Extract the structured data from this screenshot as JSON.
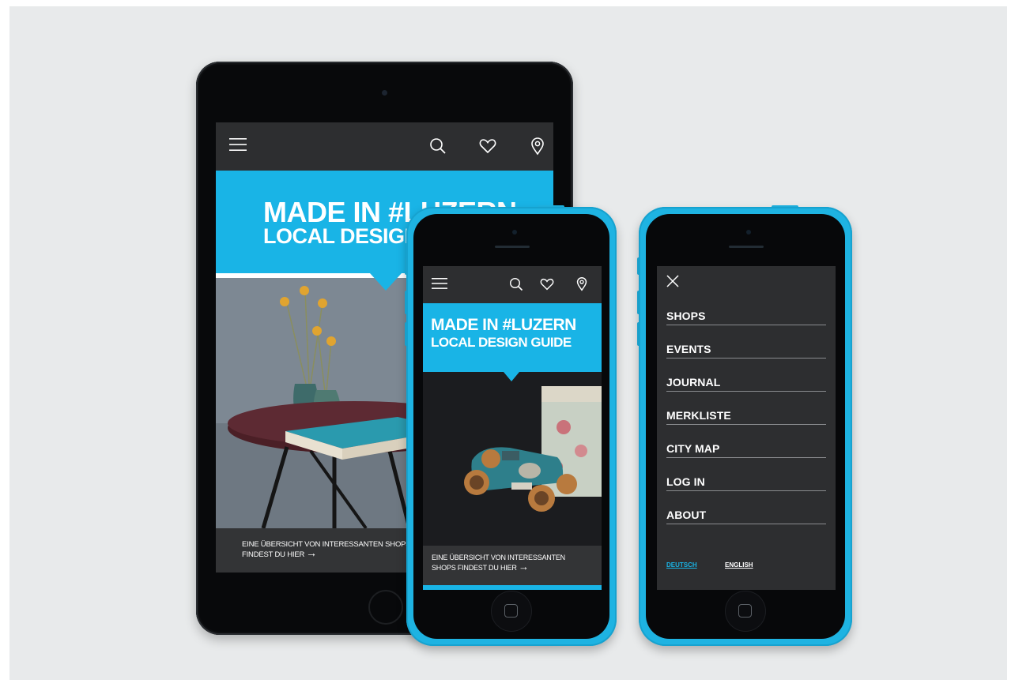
{
  "hero": {
    "line1": "MADE IN #LUZERN",
    "line2": "LOCAL DESIGN GUIDE"
  },
  "tablet": {
    "footer_line1": "EINE ÜBERSICHT VON INTERESSANTEN SHOPS",
    "footer_line2": "FINDEST DU HIER"
  },
  "phone": {
    "footer_line1": "EINE ÜBERSICHT VON INTERESSANTEN",
    "footer_line2": "SHOPS FINDEST DU HIER"
  },
  "arrow": "→",
  "menu": {
    "items": [
      "SHOPS",
      "EVENTS",
      "JOURNAL",
      "MERKLISTE",
      "CITY MAP",
      "LOG IN",
      "ABOUT"
    ],
    "languages": [
      "DEUTSCH",
      "ENGLISH"
    ],
    "active_language": "DEUTSCH"
  },
  "icons": [
    "menu-icon",
    "search-icon",
    "heart-icon",
    "location-pin-icon",
    "close-icon",
    "arrow-right-icon"
  ],
  "colors": {
    "accent": "#19b4e6",
    "nav_bg": "#2d2e30",
    "device_body_phone": "#1eb3e2",
    "device_body_tablet": "#08090b",
    "background": "#e8eaeb"
  }
}
